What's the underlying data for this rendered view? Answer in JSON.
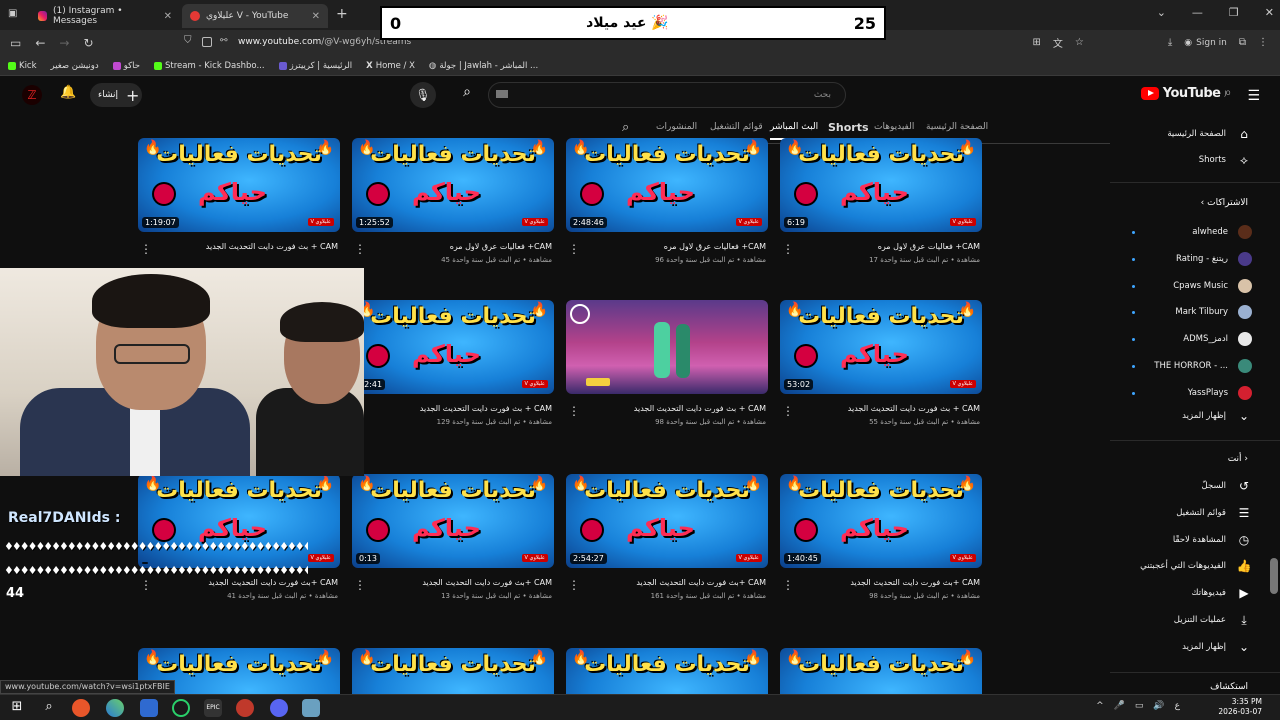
{
  "tabs": [
    {
      "title": "(1) Instagram • Messages"
    },
    {
      "title": "عليلاوي V - YouTube"
    }
  ],
  "counter": {
    "left": "0",
    "title": "عيد ميلاد 🎉",
    "right": "25"
  },
  "address": {
    "host": "www.youtube.com",
    "path": "/@V-wg6yh/streams",
    "signin": "Sign in"
  },
  "bookmarks": [
    "Kick",
    "دونيشن صغير",
    "حاكو",
    "Stream - Kick Dashbo...",
    "الرئيسية | كرييترز",
    "Home / X",
    "جولة | Jawlah - المباشر ..."
  ],
  "header": {
    "logo": "YouTube",
    "logo_sup": "JO",
    "search_placeholder": "بحث",
    "create_label": "إنشاء"
  },
  "channel_tabs": [
    "الصفحة الرئيسية",
    "الفيديوهات",
    "Shorts",
    "البث المباشر",
    "قوائم التشغيل",
    "المنشورات"
  ],
  "sidebar": {
    "home": "الصفحة الرئيسية",
    "shorts": "Shorts",
    "subs_header": "الاشتراكات",
    "subscriptions": [
      {
        "name": "alwhede",
        "color": "#5a2d1a"
      },
      {
        "name": "Rating - ريتنغ",
        "color": "#4a3a8a"
      },
      {
        "name": "Cpaws Music",
        "color": "#d8c2a8"
      },
      {
        "name": "Mark Tilbury",
        "color": "#9ab0d0"
      },
      {
        "name": "ADMS_ادمز",
        "color": "#e8e8e8"
      },
      {
        "name": "THE HORROR - ...",
        "color": "#3a8a7a"
      },
      {
        "name": "YassPlays",
        "color": "#d42030"
      }
    ],
    "show_more": "إظهار المزيد",
    "you_header": "أنت",
    "you_items": [
      "السجلّ",
      "قوائم التشغيل",
      "المشاهدة لاحقًا",
      "الفيديوهات التي أعجبتني",
      "فيديوهاتك",
      "عمليات التنزيل",
      "إظهار المزيد"
    ],
    "explore": "استكشاف"
  },
  "thumb_text": {
    "line1": "تحديات فعاليات",
    "line2": "حياكم",
    "badge": "V عليلاوي"
  },
  "videos": [
    {
      "title": "بث فورت دايت التحديث الجديد + CAM",
      "meta": "",
      "duration": "1:19:07"
    },
    {
      "title": "فعاليات عرق لاول مره +CAM",
      "meta": "45 مشاهدة • تم البث قبل سنة واحدة",
      "duration": "1:25:52"
    },
    {
      "title": "فعاليات عرق لاول مره +CAM",
      "meta": "96 مشاهدة • تم البث قبل سنة واحدة",
      "duration": "2:48:46"
    },
    {
      "title": "فعاليات عرق لاول مره +CAM",
      "meta": "17 مشاهدة • تم البث قبل سنة واحدة",
      "duration": "6:19"
    },
    {
      "title": "بث فورت دايت التحديث الجديد + CAM",
      "meta": "129 مشاهدة • تم البث قبل سنة واحدة",
      "duration": "22:41"
    },
    {
      "title": "بث فورت دايت التحديث الجديد + CAM",
      "meta": "98 مشاهدة • تم البث قبل سنة واحدة",
      "duration": ""
    },
    {
      "title": "بث فورت دايت التحديث الجديد + CAM",
      "meta": "55 مشاهدة • تم البث قبل سنة واحدة",
      "duration": "53:02"
    },
    {
      "title": "بث فورت دايت التحديث الجديد+ CAM",
      "meta": "41 مشاهدة • تم البث قبل سنة واحدة",
      "duration": ""
    },
    {
      "title": "بث فورت دايت التحديث الجديد+ CAM",
      "meta": "13 مشاهدة • تم البث قبل سنة واحدة",
      "duration": "0:13"
    },
    {
      "title": "بث فورت دايت التحديث الجديد+ CAM",
      "meta": "161 مشاهدة • تم البث قبل سنة واحدة",
      "duration": "2:54:27"
    },
    {
      "title": "بث فورت دايت التحديث الجديد+ CAM",
      "meta": "98 مشاهدة • تم البث قبل سنة واحدة",
      "duration": "1:40:45"
    }
  ],
  "overlay": {
    "chat_name": "Real7DANIds :",
    "chat_count": "44"
  },
  "status_url": "www.youtube.com/watch?v=wsi1ptxFBIE",
  "clock": {
    "time": "3:35 PM",
    "date": "2026-03-07"
  }
}
